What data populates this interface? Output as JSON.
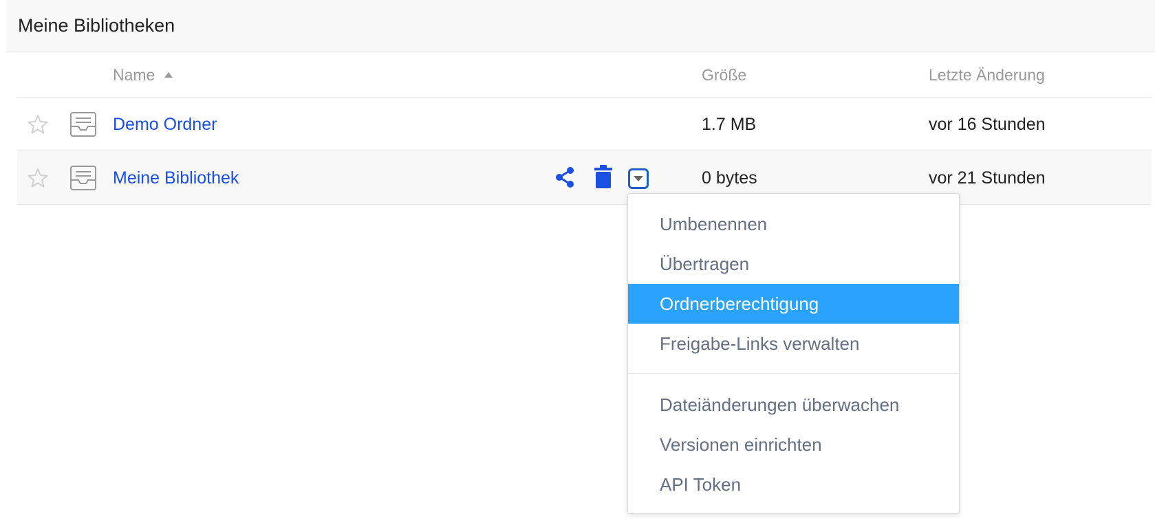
{
  "header": {
    "title": "Meine Bibliotheken"
  },
  "table": {
    "columns": {
      "name": "Name",
      "size": "Größe",
      "mtime": "Letzte Änderung"
    },
    "rows": [
      {
        "name": "Demo Ordner",
        "size": "1.7 MB",
        "mtime": "vor 16 Stunden"
      },
      {
        "name": "Meine Bibliothek",
        "size": "0 bytes",
        "mtime": "vor 21 Stunden"
      }
    ]
  },
  "menu": {
    "items": [
      "Umbenennen",
      "Übertragen",
      "Ordnerberechtigung",
      "Freigabe-Links verwalten",
      "Dateiänderungen überwachen",
      "Versionen einrichten",
      "API Token"
    ],
    "active_item": "Ordnerberechtigung"
  },
  "colors": {
    "link": "#1a4fe0",
    "menu_highlight": "#2aa3ff",
    "menu_text": "#646f83",
    "header_text": "#999999"
  },
  "icons": {
    "star": "star-icon",
    "library": "library-icon",
    "share": "share-icon",
    "trash": "trash-icon",
    "dropdown": "caret-down-icon",
    "sort": "sort-up-icon"
  }
}
